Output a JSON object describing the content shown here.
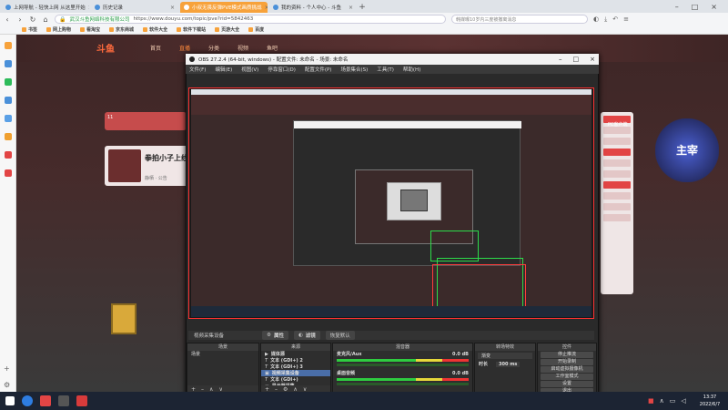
{
  "browser": {
    "tabs": [
      {
        "label": "上网导航 - 轻快上网 从这里开始",
        "active": false
      },
      {
        "label": "历史记录",
        "active": false
      },
      {
        "label": "小叔无畏反弹PVE模式画质挑战",
        "active": true
      },
      {
        "label": "我的资料 - 个人中心 - 斗鱼",
        "active": false
      }
    ],
    "address": {
      "site": "武汉斗鱼网络科技有限公司",
      "url": "https://www.douyu.com/topic/pve?rid=5842463"
    },
    "search_placeholder": "韩媒曝10岁内三度被撤离消息",
    "bookmarks": [
      "书签",
      "网上购物",
      "看淘宝",
      "京东商城",
      "软件大全",
      "软件下载站",
      "页游大全",
      "百度"
    ]
  },
  "site": {
    "logo": "斗鱼",
    "nav": [
      "首页",
      "直播",
      "分类",
      "视频",
      "鱼吧"
    ],
    "live_count": "11",
    "streamer_name": "拳拍小子上线",
    "streamer_sub": "静栖 · 公告",
    "pc_label": "PC客户端",
    "game_ad": "主宰"
  },
  "obs": {
    "title": "OBS 27.2.4 (64-bit, windows) - 配置文件: 未命名 - 场景: 未命名",
    "menu": [
      "文件(F)",
      "编辑(E)",
      "视图(V)",
      "停靠窗口(D)",
      "配置文件(P)",
      "场景集合(S)",
      "工具(T)",
      "帮助(H)"
    ],
    "source_label": "视频采集设备",
    "props_label": "属性",
    "filters_label": "滤镜",
    "defaults_label": "恢复默认",
    "docks": {
      "scenes": {
        "title": "场景",
        "items": [
          "场景"
        ]
      },
      "sources": {
        "title": "来源",
        "items": [
          "媒体源",
          "文本 (GDI+) 2",
          "文本 (GDI+) 3",
          "视频采集设备",
          "文本 (GDI+)",
          "显示器采集"
        ]
      },
      "mixer": {
        "title": "混音器",
        "channels": [
          {
            "name": "麦克风/Aux",
            "db": "0.0 dB"
          },
          {
            "name": "桌面音频",
            "db": "0.0 dB"
          }
        ]
      },
      "transitions": {
        "title": "转场特效",
        "mode": "渐变",
        "duration_label": "时长",
        "duration": "300 ms"
      },
      "controls": {
        "title": "控件",
        "buttons": [
          "停止推流",
          "开始录制",
          "启动虚拟摄像机",
          "工作室模式",
          "设置",
          "退出"
        ]
      }
    }
  },
  "taskbar": {
    "time": "13:37",
    "date": "2022/6/7"
  }
}
